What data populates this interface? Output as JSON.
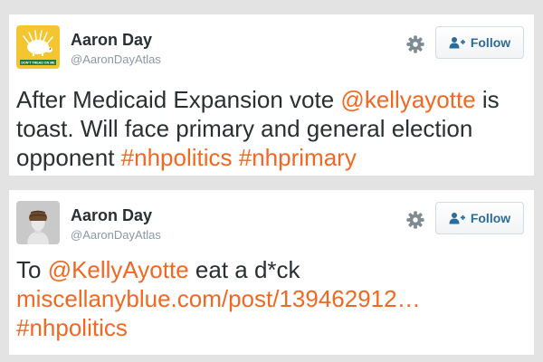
{
  "tweets": [
    {
      "author": {
        "name": "Aaron Day",
        "handle": "@AaronDayAtlas"
      },
      "avatar_caption": "DON'T TREAD ON ME",
      "follow_label": "Follow",
      "text": [
        {
          "type": "text",
          "value": "After Medicaid Expansion vote "
        },
        {
          "type": "mention",
          "value": "@kellyayotte"
        },
        {
          "type": "text",
          "value": " is toast. Will face primary and general election opponent "
        },
        {
          "type": "hashtag",
          "value": "#nhpolitics"
        },
        {
          "type": "text",
          "value": " "
        },
        {
          "type": "hashtag",
          "value": "#nhprimary"
        }
      ]
    },
    {
      "author": {
        "name": "Aaron Day",
        "handle": "@AaronDayAtlas"
      },
      "follow_label": "Follow",
      "text": [
        {
          "type": "text",
          "value": "To "
        },
        {
          "type": "mention",
          "value": "@KellyAyotte"
        },
        {
          "type": "text",
          "value": " eat a d*ck "
        },
        {
          "type": "url",
          "value": "miscellanyblue.com/post/139462912…"
        },
        {
          "type": "text",
          "value": " "
        },
        {
          "type": "hashtag",
          "value": "#nhpolitics"
        }
      ]
    }
  ],
  "colors": {
    "link": "#f26722",
    "name": "#292f33",
    "handle": "#8899a6",
    "follow_text": "#2a6c9c",
    "page_background": "#e3e3e3",
    "avatar1_background": "#f2c531"
  },
  "icons": [
    "gear-icon",
    "follow-person-plus-icon"
  ]
}
